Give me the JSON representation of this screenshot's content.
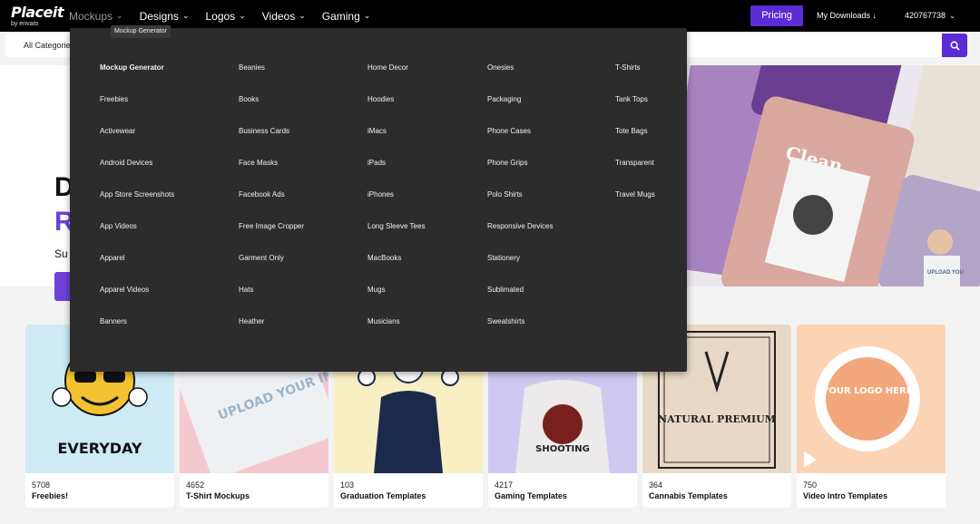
{
  "logo": {
    "brand": "Placeit",
    "sub": "by envato"
  },
  "nav": {
    "items": [
      "Mockups",
      "Designs",
      "Logos",
      "Videos",
      "Gaming"
    ],
    "pricing": "Pricing",
    "downloads": "My Downloads ↓",
    "account": "420767738"
  },
  "search": {
    "category": "All Categories"
  },
  "tooltip": "Mockup Generator",
  "hero": {
    "line1": "D",
    "line2": "R",
    "sub": "Su"
  },
  "dropdown": {
    "col1": [
      "Mockup Generator",
      "Freebies",
      "Activewear",
      "Android Devices",
      "App Store Screenshots",
      "App Videos",
      "Apparel",
      "Apparel Videos",
      "Banners"
    ],
    "col2": [
      "Beanies",
      "Books",
      "Business Cards",
      "Face Masks",
      "Facebook Ads",
      "Free Image Cropper",
      "Garment Only",
      "Hats",
      "Heather"
    ],
    "col3": [
      "Home Decor",
      "Hoodies",
      "iMacs",
      "iPads",
      "iPhones",
      "Long Sleeve Tees",
      "MacBooks",
      "Mugs",
      "Musicians"
    ],
    "col4": [
      "Onesies",
      "Packaging",
      "Phone Cases",
      "Phone Grips",
      "Polo Shirts",
      "Responsive Devices",
      "Stationery",
      "Sublimated",
      "Sweatshirts"
    ],
    "col5": [
      "T-Shirts",
      "Tank Tops",
      "Tote Bags",
      "Transparent",
      "Travel Mugs"
    ]
  },
  "cards": [
    {
      "count": "5708",
      "label": "Freebies!",
      "color": "#cdeaf5",
      "art": "EVERYDAY"
    },
    {
      "count": "4652",
      "label": "T-Shirt Mockups",
      "color": "#f5c8cf",
      "art": "UPLOAD YOUR IMAGE"
    },
    {
      "count": "103",
      "label": "Graduation Templates",
      "color": "#f8efc4",
      "art": ""
    },
    {
      "count": "4217",
      "label": "Gaming Templates",
      "color": "#cfc8f0",
      "art": "SHOOTING"
    },
    {
      "count": "364",
      "label": "Cannabis Templates",
      "color": "#e8d9c6",
      "art": "NATURAL PREMIUM"
    },
    {
      "count": "750",
      "label": "Video Intro Templates",
      "color": "#fbd3b5",
      "art": "YOUR LOGO HERE"
    }
  ],
  "hero_art": {
    "text1": "Clean.",
    "text2": "UPLOAD YOU"
  },
  "colors": {
    "accent": "#5b2bd6",
    "dropdown_bg": "#2c2c2c",
    "nav_bg": "#000000"
  }
}
